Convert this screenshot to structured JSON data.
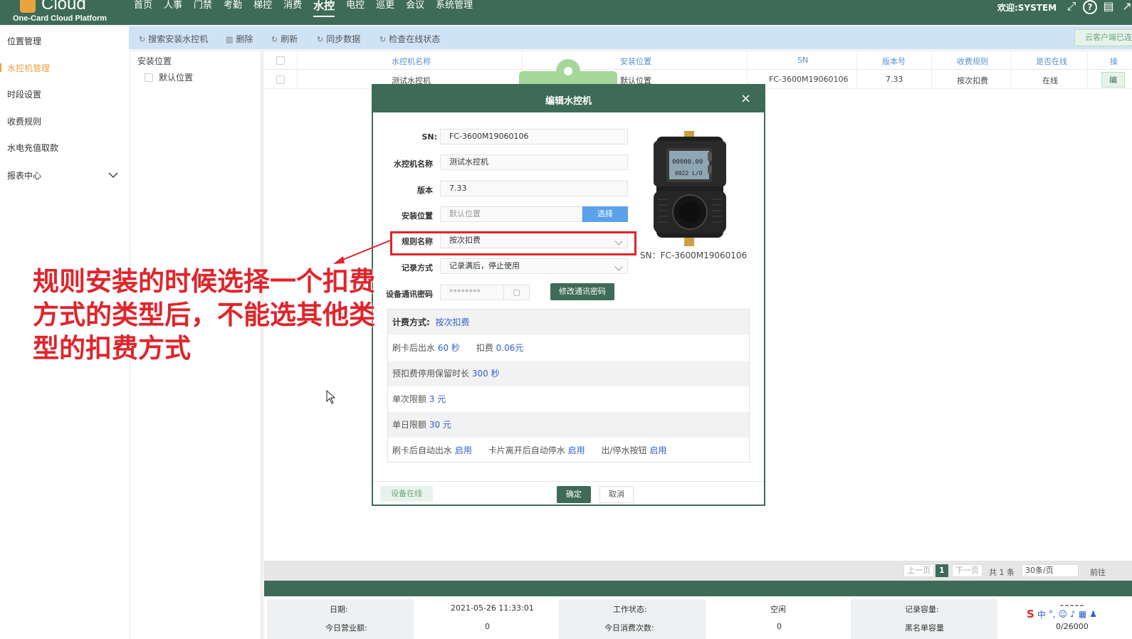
{
  "header": {
    "brand": "Cloud",
    "subtitle": "One-Card Cloud Platform",
    "nav": [
      "首页",
      "人事",
      "门禁",
      "考勤",
      "梯控",
      "消费",
      "水控",
      "电控",
      "巡更",
      "会议",
      "系统管理"
    ],
    "active_nav": "水控",
    "welcome": "欢迎:SYSTEM"
  },
  "sidebar": {
    "items": [
      "位置管理",
      "水控机管理",
      "时段设置",
      "收费规则",
      "水电充值取款",
      "报表中心"
    ],
    "active": "水控机管理"
  },
  "toolbar": {
    "buttons": [
      "搜索安装水控机",
      "删除",
      "刷新",
      "同步数据",
      "检查在线状态"
    ],
    "right_tag": "云客户端已连"
  },
  "tree": {
    "header": "安装位置",
    "node": "默认位置"
  },
  "table": {
    "columns": [
      "水控机名称",
      "安装位置",
      "SN",
      "版本号",
      "收费规则",
      "是否在线",
      "操"
    ],
    "row": [
      "测试水控机",
      "默认位置",
      "FC-3600M19060106",
      "7.33",
      "按次扣费",
      "在线",
      "编"
    ]
  },
  "pager": {
    "prev": "上一页",
    "page": "1",
    "next": "下一页",
    "total": "共 1 条",
    "size": "30条/页",
    "goto": "前往"
  },
  "status": {
    "date_label": "日期:",
    "date_value": "2021-05-26 11:33:01",
    "work_label": "工作状态:",
    "work_value": "空闲",
    "capacity_label": "记录容量:",
    "capacity_value": "60000",
    "revenue_label": "今日营业额:",
    "revenue_value": "0",
    "count_label": "今日消费次数:",
    "count_value": "0",
    "blacklist_label": "黑名单容量",
    "blacklist_value": "0/26000"
  },
  "dialog": {
    "title": "编辑水控机",
    "close": "×",
    "sn_label": "SN:",
    "sn_value": "FC-3600M19060106",
    "name_label": "水控机名称",
    "name_value": "测试水控机",
    "version_label": "版本",
    "version_value": "7.33",
    "location_label": "安装位置",
    "location_placeholder": "默认位置",
    "select_label": "选择",
    "rule_label": "规则名称",
    "rule_value": "按次扣费",
    "record_label": "记录方式",
    "record_value": "记录满后，停止使用",
    "password_label": "设备通讯密码",
    "password_value": "********",
    "change_password": "修改通讯密码",
    "device_sn_caption": "SN：FC-3600M19060106",
    "device_screen_1": "00000.00",
    "device_screen_2": "0022 L/O",
    "billing_label": "计费方式:",
    "billing_value": "按次扣费",
    "row1_a": "刷卡后出水",
    "row1_b": "60 秒",
    "row1_c": "扣费",
    "row1_d": "0.06元",
    "row2_a": "预扣费停用保留时长",
    "row2_b": "300 秒",
    "row3_a": "单次限额",
    "row3_b": "3 元",
    "row4_a": "单日限额",
    "row4_b": "30 元",
    "row5_a": "刷卡后自动出水",
    "row5_b": "启用",
    "row5_c": "卡片离开后自动停水",
    "row5_d": "启用",
    "row5_e": "出/停水按钮",
    "row5_f": "启用",
    "online": "设备在线",
    "ok": "确定",
    "cancel": "取消"
  },
  "annotation": {
    "text": "规则安装的时候选择一个扣费方式的类型后，不能选其他类型的扣费方式"
  },
  "ime": {
    "lang": "中"
  },
  "colors": {
    "primary_green": "#3e6b58",
    "accent_orange": "#e8a33c",
    "annotation_red": "#e0242b",
    "link_blue": "#2e5fc8"
  }
}
